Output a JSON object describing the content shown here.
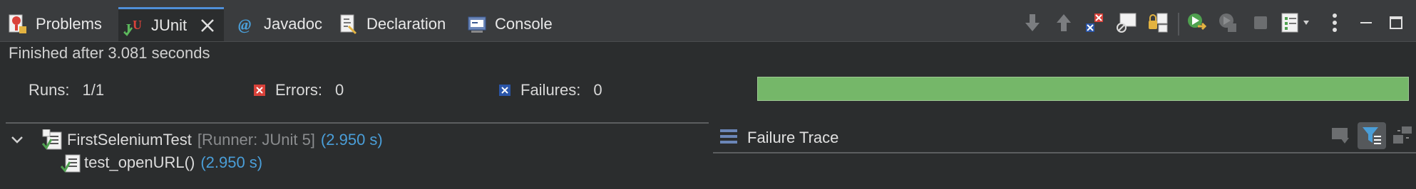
{
  "tabs": [
    {
      "label": "Problems"
    },
    {
      "label": "JUnit"
    },
    {
      "label": "Javadoc"
    },
    {
      "label": "Declaration"
    },
    {
      "label": "Console"
    }
  ],
  "status": "Finished after 3.081 seconds",
  "counters": {
    "runs_label": "Runs:",
    "runs_value": "1/1",
    "errors_label": "Errors:",
    "errors_value": "0",
    "failures_label": "Failures:",
    "failures_value": "0"
  },
  "progress": {
    "fraction": 1.0,
    "color": "#75b769"
  },
  "tree": {
    "suite": {
      "name": "FirstSeleniumTest",
      "runner": "[Runner: JUnit 5]",
      "time": "(2.950 s)"
    },
    "test": {
      "name": "test_openURL()",
      "time": "(2.950 s)"
    }
  },
  "failure_trace": {
    "title": "Failure Trace"
  },
  "colors": {
    "accent": "#4f8fd8",
    "success": "#75b769",
    "error": "#d9423a",
    "time": "#4a9ed8"
  }
}
